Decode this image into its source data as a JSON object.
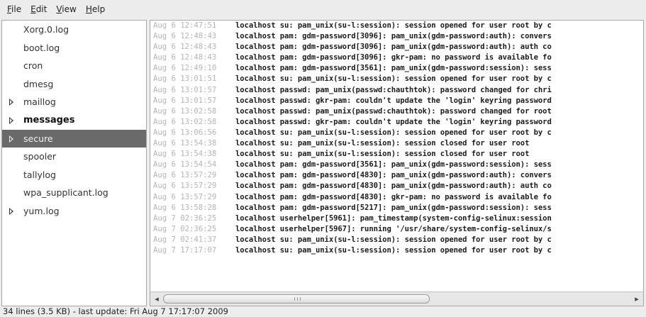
{
  "menu": {
    "items": [
      {
        "first": "F",
        "rest": "ile"
      },
      {
        "first": "E",
        "rest": "dit"
      },
      {
        "first": "V",
        "rest": "iew"
      },
      {
        "first": "H",
        "rest": "elp"
      }
    ]
  },
  "sidebar": {
    "items": [
      {
        "label": "Xorg.0.log",
        "expandable": false,
        "bold": false,
        "selected": false
      },
      {
        "label": "boot.log",
        "expandable": false,
        "bold": false,
        "selected": false
      },
      {
        "label": "cron",
        "expandable": false,
        "bold": false,
        "selected": false
      },
      {
        "label": "dmesg",
        "expandable": false,
        "bold": false,
        "selected": false
      },
      {
        "label": "maillog",
        "expandable": true,
        "bold": false,
        "selected": false
      },
      {
        "label": "messages",
        "expandable": true,
        "bold": true,
        "selected": false
      },
      {
        "label": "secure",
        "expandable": true,
        "bold": false,
        "selected": true
      },
      {
        "label": "spooler",
        "expandable": false,
        "bold": false,
        "selected": false
      },
      {
        "label": "tallylog",
        "expandable": false,
        "bold": false,
        "selected": false
      },
      {
        "label": "wpa_supplicant.log",
        "expandable": false,
        "bold": false,
        "selected": false
      },
      {
        "label": "yum.log",
        "expandable": true,
        "bold": false,
        "selected": false
      }
    ]
  },
  "log": {
    "lines": [
      {
        "ts": "Aug  6 12:47:51",
        "msg": "localhost su: pam_unix(su-l:session): session opened for user root by c"
      },
      {
        "ts": "Aug  6 12:48:43",
        "msg": "localhost pam: gdm-password[3096]: pam_unix(gdm-password:auth): convers"
      },
      {
        "ts": "Aug  6 12:48:43",
        "msg": "localhost pam: gdm-password[3096]: pam_unix(gdm-password:auth): auth co"
      },
      {
        "ts": "Aug  6 12:48:43",
        "msg": "localhost pam: gdm-password[3096]: gkr-pam: no password is available fo"
      },
      {
        "ts": "Aug  6 12:49:10",
        "msg": "localhost pam: gdm-password[3561]: pam_unix(gdm-password:session): sess"
      },
      {
        "ts": "Aug  6 13:01:51",
        "msg": "localhost su: pam_unix(su-l:session): session opened for user root by c"
      },
      {
        "ts": "Aug  6 13:01:57",
        "msg": "localhost passwd: pam_unix(passwd:chauthtok): password changed for chri"
      },
      {
        "ts": "Aug  6 13:01:57",
        "msg": "localhost passwd: gkr-pam: couldn't update the 'login' keyring password"
      },
      {
        "ts": "Aug  6 13:02:58",
        "msg": "localhost passwd: pam_unix(passwd:chauthtok): password changed for root"
      },
      {
        "ts": "Aug  6 13:02:58",
        "msg": "localhost passwd: gkr-pam: couldn't update the 'login' keyring password"
      },
      {
        "ts": "Aug  6 13:06:56",
        "msg": "localhost su: pam_unix(su-l:session): session opened for user root by c"
      },
      {
        "ts": "Aug  6 13:54:38",
        "msg": "localhost su: pam_unix(su-l:session): session closed for user root"
      },
      {
        "ts": "Aug  6 13:54:38",
        "msg": "localhost su: pam_unix(su-l:session): session closed for user root"
      },
      {
        "ts": "Aug  6 13:54:54",
        "msg": "localhost pam: gdm-password[3561]: pam_unix(gdm-password:session): sess"
      },
      {
        "ts": "Aug  6 13:57:29",
        "msg": "localhost pam: gdm-password[4830]: pam_unix(gdm-password:auth): convers"
      },
      {
        "ts": "Aug  6 13:57:29",
        "msg": "localhost pam: gdm-password[4830]: pam_unix(gdm-password:auth): auth co"
      },
      {
        "ts": "Aug  6 13:57:29",
        "msg": "localhost pam: gdm-password[4830]: gkr-pam: no password is available fo"
      },
      {
        "ts": "Aug  6 13:58:28",
        "msg": "localhost pam: gdm-password[5217]: pam_unix(gdm-password:session): sess"
      },
      {
        "ts": "Aug  7 02:36:25",
        "msg": "localhost userhelper[5961]: pam_timestamp(system-config-selinux:session"
      },
      {
        "ts": "Aug  7 02:36:25",
        "msg": "localhost userhelper[5967]: running '/usr/share/system-config-selinux/s"
      },
      {
        "ts": "Aug  7 02:41:37",
        "msg": "localhost su: pam_unix(su-l:session): session opened for user root by c"
      },
      {
        "ts": "Aug  7 17:17:07",
        "msg": "localhost su: pam_unix(su-l:session): session opened for user root by c"
      }
    ]
  },
  "hscroll": {
    "thumb_position": 0,
    "thumb_fraction": 0.57
  },
  "status": {
    "text": "34 lines (3.5 KB) - last update: Fri Aug  7 17:17:07 2009"
  }
}
